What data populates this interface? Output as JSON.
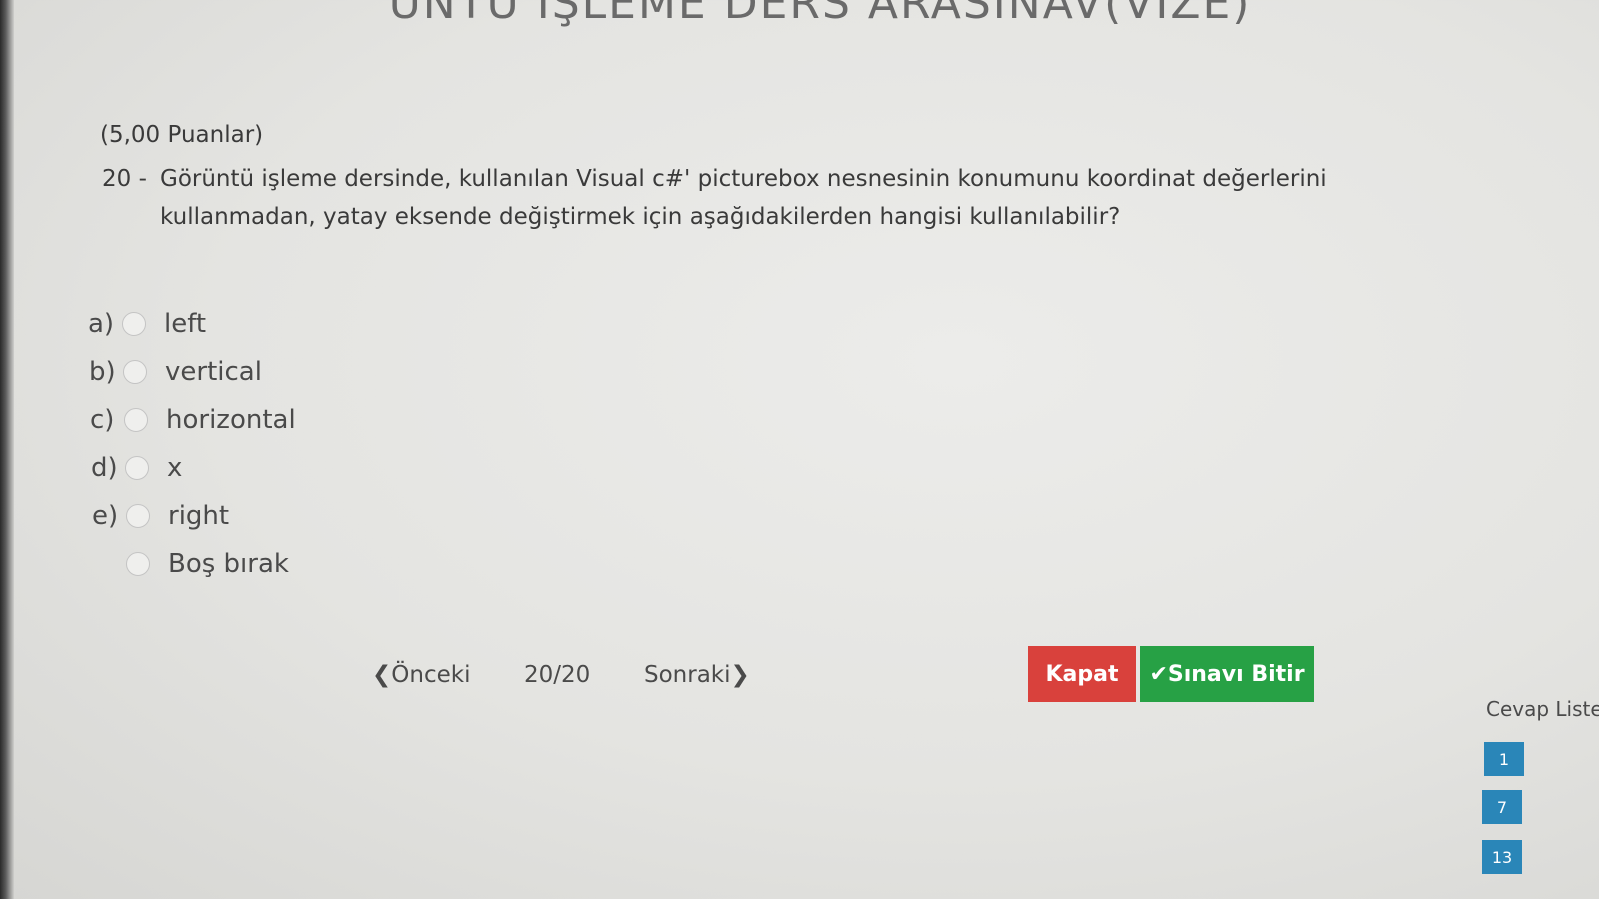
{
  "exam": {
    "title": "ÜNTÜ İŞLEME DERS ARASINAV(VİZE)"
  },
  "question": {
    "points": "(5,00 Puanlar)",
    "number": "20 -",
    "text": "Görüntü işleme dersinde, kullanılan Visual c#' picturebox nesnesinin konumunu koordinat değerlerini kullanmadan, yatay eksende değiştirmek için aşağıdakilerden hangisi kullanılabilir?"
  },
  "options": [
    {
      "letter": "a)",
      "label": "left"
    },
    {
      "letter": "b)",
      "label": "vertical"
    },
    {
      "letter": "c)",
      "label": "horizontal"
    },
    {
      "letter": "d)",
      "label": "x"
    },
    {
      "letter": "e)",
      "label": "right"
    },
    {
      "letter": "",
      "label": "Boş bırak"
    }
  ],
  "navigation": {
    "prev": "❮Önceki",
    "counter": "20/20",
    "next": "Sonraki❯"
  },
  "buttons": {
    "close": "Kapat",
    "finish": "✔Sınavı Bitir"
  },
  "answer_list": {
    "title": "Cevap Listesi",
    "items": [
      "1",
      "7",
      "13"
    ],
    "color": "#2a86b8"
  },
  "colors": {
    "close_button": "#d9413c",
    "finish_button": "#27a145"
  }
}
